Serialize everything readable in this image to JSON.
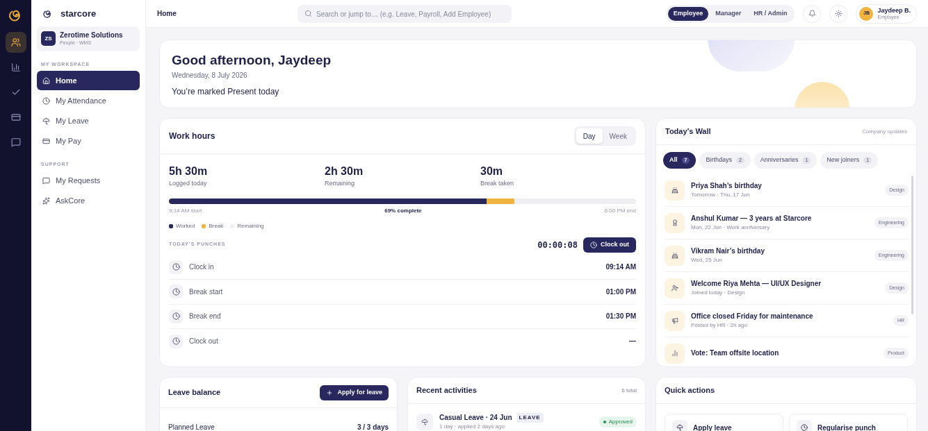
{
  "brand": {
    "name": "starcore"
  },
  "org": {
    "initials": "ZS",
    "name": "Zerotime Solutions",
    "subtitle": "People · WMS"
  },
  "sidebar": {
    "sections": [
      {
        "title": "MY WORKSPACE",
        "items": [
          {
            "label": "Home",
            "selected": true
          },
          {
            "label": "My Attendance",
            "selected": false
          },
          {
            "label": "My Leave",
            "selected": false
          },
          {
            "label": "My Pay",
            "selected": false
          }
        ]
      },
      {
        "title": "SUPPORT",
        "items": [
          {
            "label": "My Requests",
            "selected": false
          },
          {
            "label": "AskCore",
            "selected": false
          }
        ]
      }
    ]
  },
  "rail": {
    "items": [
      {
        "selected": true
      },
      {
        "selected": false
      },
      {
        "selected": false
      },
      {
        "selected": false
      },
      {
        "selected": false
      }
    ]
  },
  "header": {
    "breadcrumb": "Home",
    "search": {
      "placeholder": "Search or jump to… (e.g. Leave, Payroll, Add Employee)"
    },
    "roles": [
      {
        "label": "Employee",
        "selected": true
      },
      {
        "label": "Manager",
        "selected": false
      },
      {
        "label": "HR / Admin",
        "selected": false
      }
    ],
    "user": {
      "initials": "JB",
      "name": "Jaydeep B.",
      "role": "Employee"
    }
  },
  "greeting": {
    "title": "Good afternoon, Jaydeep",
    "date": "Wednesday, 8 July 2026",
    "status": "You’re marked Present today"
  },
  "work_hours": {
    "title": "Work hours",
    "toggle": [
      {
        "label": "Day",
        "selected": true
      },
      {
        "label": "Week",
        "selected": false
      }
    ],
    "stats": [
      {
        "value": "5h 30m",
        "label": "Logged today"
      },
      {
        "value": "2h 30m",
        "label": "Remaining"
      },
      {
        "value": "30m",
        "label": "Break taken"
      }
    ],
    "progress": {
      "worked": {
        "level": 0.68
      },
      "worked_and_break": {
        "level": 0.74
      },
      "start": "9:14 AM start",
      "complete": "69% complete",
      "end": "6:00 PM end"
    },
    "legend": [
      {
        "label": "Worked",
        "color": "#28285e"
      },
      {
        "label": "Break",
        "color": "#f0b441"
      },
      {
        "label": "Remaining",
        "color": "#efeff3"
      }
    ],
    "punches_title": "TODAY’S PUNCHES",
    "timer": "00:00:08",
    "clock_out_button": "Clock out",
    "punches": [
      {
        "label": "Clock in",
        "time": "09:14 AM"
      },
      {
        "label": "Break start",
        "time": "01:00 PM"
      },
      {
        "label": "Break end",
        "time": "01:30 PM"
      },
      {
        "label": "Clock out",
        "time": "—"
      }
    ]
  },
  "wall": {
    "title": "Today’s Wall",
    "subtitle": "Company updates",
    "filters": [
      {
        "label": "All",
        "count": "7",
        "selected": true
      },
      {
        "label": "Birthdays",
        "count": "2",
        "selected": false
      },
      {
        "label": "Anniversaries",
        "count": "1",
        "selected": false
      },
      {
        "label": "New joiners",
        "count": "1",
        "selected": false
      }
    ],
    "items": [
      {
        "kind": "birthday",
        "title": "Priya Shah’s birthday",
        "meta": "Tomorrow · Thu, 17 Jun",
        "tag": "Design"
      },
      {
        "kind": "anniversary",
        "title": "Anshul Kumar — 3 years at Starcore",
        "meta": "Mon, 22 Jun · Work anniversary",
        "tag": "Engineering"
      },
      {
        "kind": "birthday",
        "title": "Vikram Nair’s birthday",
        "meta": "Wed, 25 Jun",
        "tag": "Engineering"
      },
      {
        "kind": "joiner",
        "title": "Welcome Riya Mehta — UI/UX Designer",
        "meta": "Joined today · Design",
        "tag": "Design"
      },
      {
        "kind": "announcement",
        "title": "Office closed Friday for maintenance",
        "meta": "Posted by HR · 2h ago",
        "tag": "HR"
      },
      {
        "kind": "poll",
        "title": "Vote: Team offsite location",
        "tag": "Product"
      }
    ]
  },
  "leave_balance": {
    "title": "Leave balance",
    "button": "Apply for leave",
    "rows": [
      {
        "label": "Planned Leave",
        "value": "3 / 3 days"
      }
    ]
  },
  "recent_activities": {
    "title": "Recent activities",
    "count": "6 total",
    "items": [
      {
        "title": "Casual Leave · 24 Jun",
        "badge": "LEAVE",
        "meta": "1 day · applied 2 days ago",
        "status": "Approved"
      }
    ]
  },
  "quick_actions": {
    "title": "Quick actions",
    "items": [
      {
        "label": "Apply leave"
      },
      {
        "label": "Regularise punch"
      }
    ]
  }
}
